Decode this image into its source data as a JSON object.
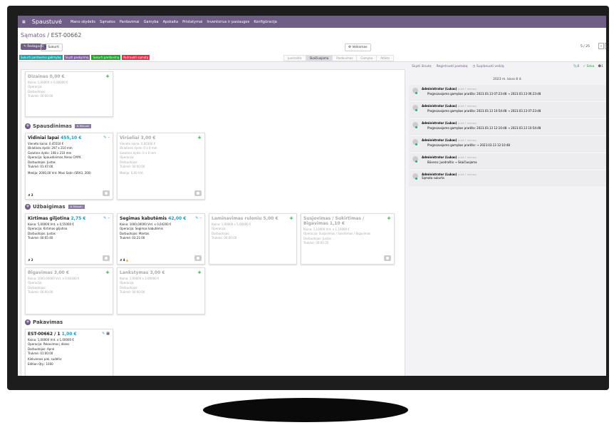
{
  "nav": {
    "app": "Spaustuvė",
    "menu": [
      "Mano skydelis",
      "Sąmatos",
      "Pardavimai",
      "Gamyba",
      "Apskaita",
      "Pristatymai",
      "Inventorius ir pasiaugos",
      "Konfigūracija"
    ]
  },
  "breadcrumb": {
    "parent": "Sąmatos",
    "current": "EST-00662"
  },
  "actions": {
    "edit": "Redaguoti",
    "create": "+ Sukurti",
    "follow": "Veiksmas",
    "pager": "5 / 25"
  },
  "status_buttons": [
    {
      "label": "Sukurti pardavimo galimybę",
      "color": "#1ea1a1"
    },
    {
      "label": "Siųsti paskyrimą",
      "color": "#7f5e9b"
    },
    {
      "label": "Sukurti pardavimą",
      "color": "#21a034"
    },
    {
      "label": "Nutraukti sąmatą",
      "color": "#d9324a"
    }
  ],
  "stages": [
    "Juodraštis",
    "Skaičiuojama",
    "Pardavimas",
    "Gamyba",
    "Atlikta"
  ],
  "active_stage": "Skaičiuojama",
  "sections": {
    "print": "Spausdinimas",
    "finish": "Užbaigimas",
    "pack": "Pakavimas",
    "rikiuoti": "Rikiuoti"
  },
  "cards": {
    "dizainas": {
      "title": "Dizainas",
      "price": "0,00 €",
      "lines": [
        "Kaina: 1,00000 × 0,00000 €",
        "Operacija:",
        "Darbuotojas:",
        "Trukmė: 00:00:00"
      ]
    },
    "vidiniai": {
      "title": "Vidiniai lapai",
      "price": "455,10 €",
      "lines": [
        "Vieneto kaina: 0,45510 €",
        "Išklotinės dydis: 297 x 210 mm",
        "Galutinis dydis: 148 x 210 mm",
        "Operacija: Spausdinimas Xerox CMYK",
        "Darbuotojas: Justas",
        "Trukmė: 01:47:00",
        "Medija: 2000,00 Vnt. Maxi Satin (SRA3, 200)"
      ],
      "count": "2"
    },
    "virseliai": {
      "title": "Viršeliai",
      "price": "3,00 €",
      "lines": [
        "Vieneto kaina: 0,00300 €",
        "Išklotinės dydis: 0 x 0 mm",
        "Galutinis dydis: 0 x 0 mm",
        "Operacija:",
        "Darbuotojas:",
        "Trukmė: 00:00:00",
        "Medija: 0,00 Vnt."
      ]
    },
    "kirtimas": {
      "title": "Kirtimas giljotina",
      "price": "2,75 €",
      "lines": [
        "Kaina: 5,00000 Vnt. x 0,55000 €",
        "Operacija: Kirtimas giljotina",
        "Darbuotojas: Justas",
        "Trukmė: 00:05:40"
      ],
      "count": "2"
    },
    "segimas": {
      "title": "Segimas kabutėmis",
      "price": "42,00 €",
      "lines": [
        "Kaina: 1000,00000 Vnt. x 0,04200 €",
        "Operacija: Segimas kabutėmis",
        "Darbuotojas: Mantas",
        "Trukmė: 03:21:00"
      ],
      "count": "4"
    },
    "laminavimas": {
      "title": "Laminavimas ruloniu",
      "price": "5,00 €",
      "lines": [
        "Kaina: 1,00000 x 5,00000 €",
        "Operacija:",
        "Darbuotojas:",
        "Trukmė: 00:00:00"
      ]
    },
    "susjovimas": {
      "title": "Susjovimas / Sukirtimas / Bigavimas",
      "price": "1,10 €",
      "lines": [
        "Kaina: 1,10000 Vnt. x 1,10000 €",
        "Operacija: Susjovimas / Sukirtimas / Bigavimas",
        "Darbuotojas: Justas",
        "Trukmė: 00:05:35"
      ]
    },
    "bigavimas": {
      "title": "Bigavimas",
      "price": "3,00 €",
      "lines": [
        "Kaina: 1000,00000 Vnt. x 0,00300 €",
        "Operacija:",
        "Darbuotojas:",
        "Trukmė: 00:00:00"
      ]
    },
    "lankstymas": {
      "title": "Lankstymas",
      "price": "3,00 €",
      "lines": [
        "Kaina: 1,00000 x 3,00000 €",
        "Operacija:",
        "Darbuotojas:",
        "Trukmė: 00:00:00"
      ]
    },
    "pack": {
      "title": "EST-00662 / 1",
      "price": "1,00 €",
      "lines": [
        "Kaina: 1,00000 Vnt. x 1,00000 €",
        "Operacija: Pakavimas į dėzes",
        "Darbuotojas: Apnė",
        "Trukmė: 01:00:00",
        "Kiekvienos pak. sudėtis:",
        "Edition Qty.: 1000"
      ],
      "count": "1"
    }
  },
  "chatter": {
    "tabs": [
      "Siųsti žinutę",
      "Registruoti pastabą",
      "Suplanuoti veiklą"
    ],
    "attach": "0",
    "follow": "Seka",
    "followers": "1",
    "date": "2023 m. kovo 8 d.",
    "messages": [
      {
        "author": "Administrator (Lukas)",
        "time": "prieš 1 mėnesį",
        "text": "Prognozuojama gamybos pradžia: 2023.03.13 07:23:48 → 2023.03.13 06:23:48"
      },
      {
        "author": "Administrator (Lukas)",
        "time": "prieš 1 mėnesį",
        "text": "Prognozuojama gamybos pradžia: 2023.03.13 10:54:48 → 2023.03.13 07:23:48"
      },
      {
        "author": "Administrator (Lukas)",
        "time": "prieš 1 mėnesį",
        "text": "Prognozuojama gamybos pradžia: 2023.03.13 12:10:48 → 2023.03.13 10:54:48"
      },
      {
        "author": "Administrator (Lukas)",
        "time": "prieš 1 mėnesį",
        "text": "Prognozuojama gamybos pradžia: → 2023.03.13 12:10:48"
      },
      {
        "author": "Administrator (Lukas)",
        "time": "prieš 1 mėnesį",
        "text": "Būsena: Juodraštis → Skaičiuojama"
      },
      {
        "author": "Administrator (Lukas)",
        "time": "prieš 1 mėnesį",
        "text": "Sąmata sukurta"
      }
    ]
  }
}
